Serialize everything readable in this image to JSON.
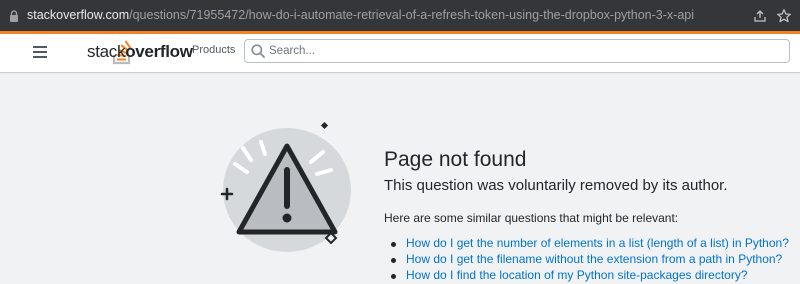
{
  "browser": {
    "url_host": "stackoverflow.com",
    "url_path": "/questions/71955472/how-do-i-automate-retrieval-of-a-refresh-token-using-the-dropbox-python-3-x-api"
  },
  "header": {
    "logo_text_light": "stack",
    "logo_text_bold": "overflow",
    "products_label": "Products",
    "search_placeholder": "Search..."
  },
  "main": {
    "title": "Page not found",
    "subtitle": "This question was voluntarily removed by its author.",
    "similar_intro": "Here are some similar questions that might be relevant:",
    "similar_questions": [
      "How do I get the number of elements in a list (length of a list) in Python?",
      "How do I get the filename without the extension from a path in Python?",
      "How do I find the location of my Python site-packages directory?"
    ]
  },
  "colors": {
    "accent": "#f48225",
    "link": "#0074cc",
    "browser_bar": "#35363a"
  },
  "icons": {
    "lock": "lock-icon",
    "share": "share-icon",
    "star": "star-icon",
    "menu": "hamburger-menu-icon",
    "search": "search-icon",
    "warning": "warning-triangle-icon"
  }
}
